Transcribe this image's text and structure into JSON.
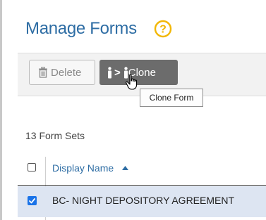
{
  "header": {
    "title": "Manage Forms",
    "help_icon": "question-circle-icon",
    "accent": "#2e6da4"
  },
  "toolbar": {
    "delete_label": "Delete",
    "delete_icon": "trash-icon",
    "clone_label": "Clone",
    "clone_icon": "person-arrow-person-icon",
    "clone_tooltip": "Clone Form"
  },
  "summary": {
    "form_sets": "13 Form Sets"
  },
  "table": {
    "columns": [
      {
        "label": "Display Name",
        "sort": "ascending"
      }
    ],
    "rows": [
      {
        "name": "BC- NIGHT DEPOSITORY AGREEMENT",
        "selected": true
      }
    ]
  }
}
